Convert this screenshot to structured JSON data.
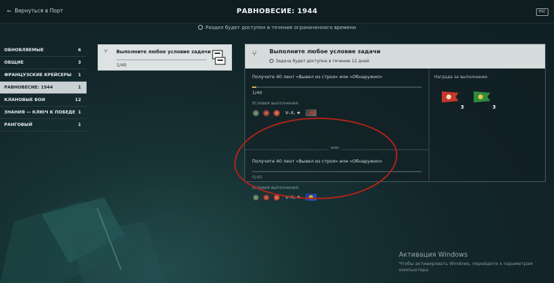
{
  "header": {
    "back_label": "Вернуться в Порт",
    "title": "РАВНОВЕСИЕ: 1944",
    "esc_label": "ESC",
    "notice": "Раздел будет доступен в течение ограниченного времени"
  },
  "sidebar": {
    "items": [
      {
        "label": "ОБНОВЛЯЕМЫЕ",
        "count": "6"
      },
      {
        "label": "ОБЩИЕ",
        "count": "3"
      },
      {
        "label": "ФРАНЦУЗСКИЕ КРЕЙСЕРЫ",
        "count": "1"
      },
      {
        "label": "РАВНОВЕСИЕ: 1944",
        "count": "1"
      },
      {
        "label": "КЛАНОВЫЕ БОИ",
        "count": "12"
      },
      {
        "label": "ЗНАНИЯ — КЛЮЧ К ПОБЕДЕ",
        "count": "1"
      },
      {
        "label": "РАНГОВЫЙ",
        "count": "1"
      }
    ],
    "active_index": 3
  },
  "task_card": {
    "title": "Выполните любое условие задачи",
    "progress": "1/40",
    "progress_fraction": 0.025
  },
  "panel": {
    "title": "Выполните любое условие задачи",
    "subtitle": "Задача будет доступна в течение 12 дней",
    "option1": {
      "text": "Получите 40 лент «Вывел из строя» или «Обнаружил»",
      "progress": "1/40",
      "progress_fraction": 0.025,
      "conditions_label": "Условия выполнения:",
      "tier": "V–X, ★"
    },
    "or_label": "или",
    "option2": {
      "text": "Получите 40 лент «Вывел из строя» или «Обнаружил»",
      "progress": "0/40",
      "progress_fraction": 0,
      "conditions_label": "Условия выполнения:",
      "tier": "V–X, ★"
    },
    "reward": {
      "label": "Награда за выполнение:",
      "items": [
        {
          "icon": "red-signal-flag-icon",
          "qty": "3"
        },
        {
          "icon": "green-signal-flag-icon",
          "qty": "3"
        }
      ]
    }
  },
  "watermark": {
    "title": "Активация Windows",
    "text": "Чтобы активировать Windows, перейдите к параметрам компьютера."
  },
  "colors": {
    "accent_progress": "#d9b24c",
    "annotation_red": "#b42318",
    "header_bg": "#0f1d21"
  }
}
